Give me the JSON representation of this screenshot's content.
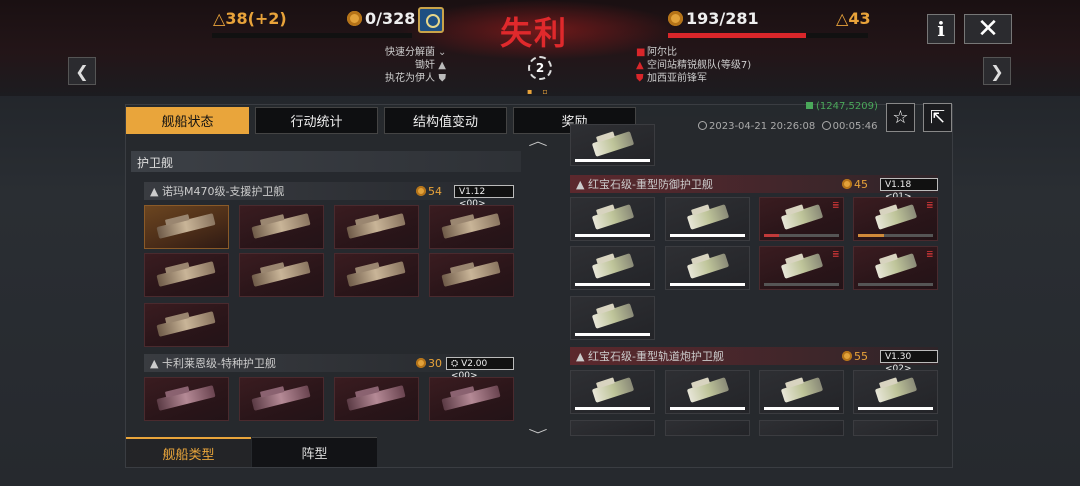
{
  "header": {
    "result": "失利",
    "left": {
      "delta": "38(+2)",
      "resource": "0/328",
      "bar_fill": 0
    },
    "right": {
      "delta": "43",
      "resource": "193/281",
      "bar_fill": 0.69
    },
    "info_label": "i",
    "close_label": "✕",
    "round_number": "2",
    "left_team_lines": [
      "快速分解菌",
      "锄奸",
      "执花为伊人"
    ],
    "right_team_lines": [
      "阿尔比",
      "空间站精锐舰队(等级7)",
      "加西亚前锋军"
    ],
    "nav_left": "❮",
    "nav_right": "❯"
  },
  "tabs": [
    {
      "label": "舰船状态",
      "active": true
    },
    {
      "label": "行动统计",
      "active": false
    },
    {
      "label": "结构值变动",
      "active": false
    },
    {
      "label": "奖励",
      "active": false
    }
  ],
  "meta": {
    "uid": "(1247,5209)",
    "datetime": "2023-04-21 20:26:08",
    "duration": "00:05:46"
  },
  "section_title": "护卫舰",
  "classes": [
    {
      "name": "诺玛M470级-支援护卫舰",
      "cost": "54",
      "version": "V1.12 <00>"
    },
    {
      "name": "卡利莱恩级-特种护卫舰",
      "cost": "30",
      "version": "V2.00 <00>"
    },
    {
      "name": "红宝石级-重型防御护卫舰",
      "cost": "45",
      "version": "V1.18 <01>"
    },
    {
      "name": "红宝石级-重型轨道炮护卫舰",
      "cost": "55",
      "version": "V1.30 <02>"
    }
  ],
  "ship_hp": {
    "defense": [
      1,
      1,
      0.2,
      0.35,
      1,
      1,
      0,
      0,
      1
    ],
    "railgun": [
      1,
      1,
      1,
      1
    ]
  },
  "bottom_tabs": [
    {
      "label": "舰船类型",
      "active": true
    },
    {
      "label": "阵型",
      "active": false
    }
  ],
  "colors": {
    "accent": "#e9a53b",
    "defeat": "#e0292c",
    "enemy_bar": "#d9262a"
  }
}
